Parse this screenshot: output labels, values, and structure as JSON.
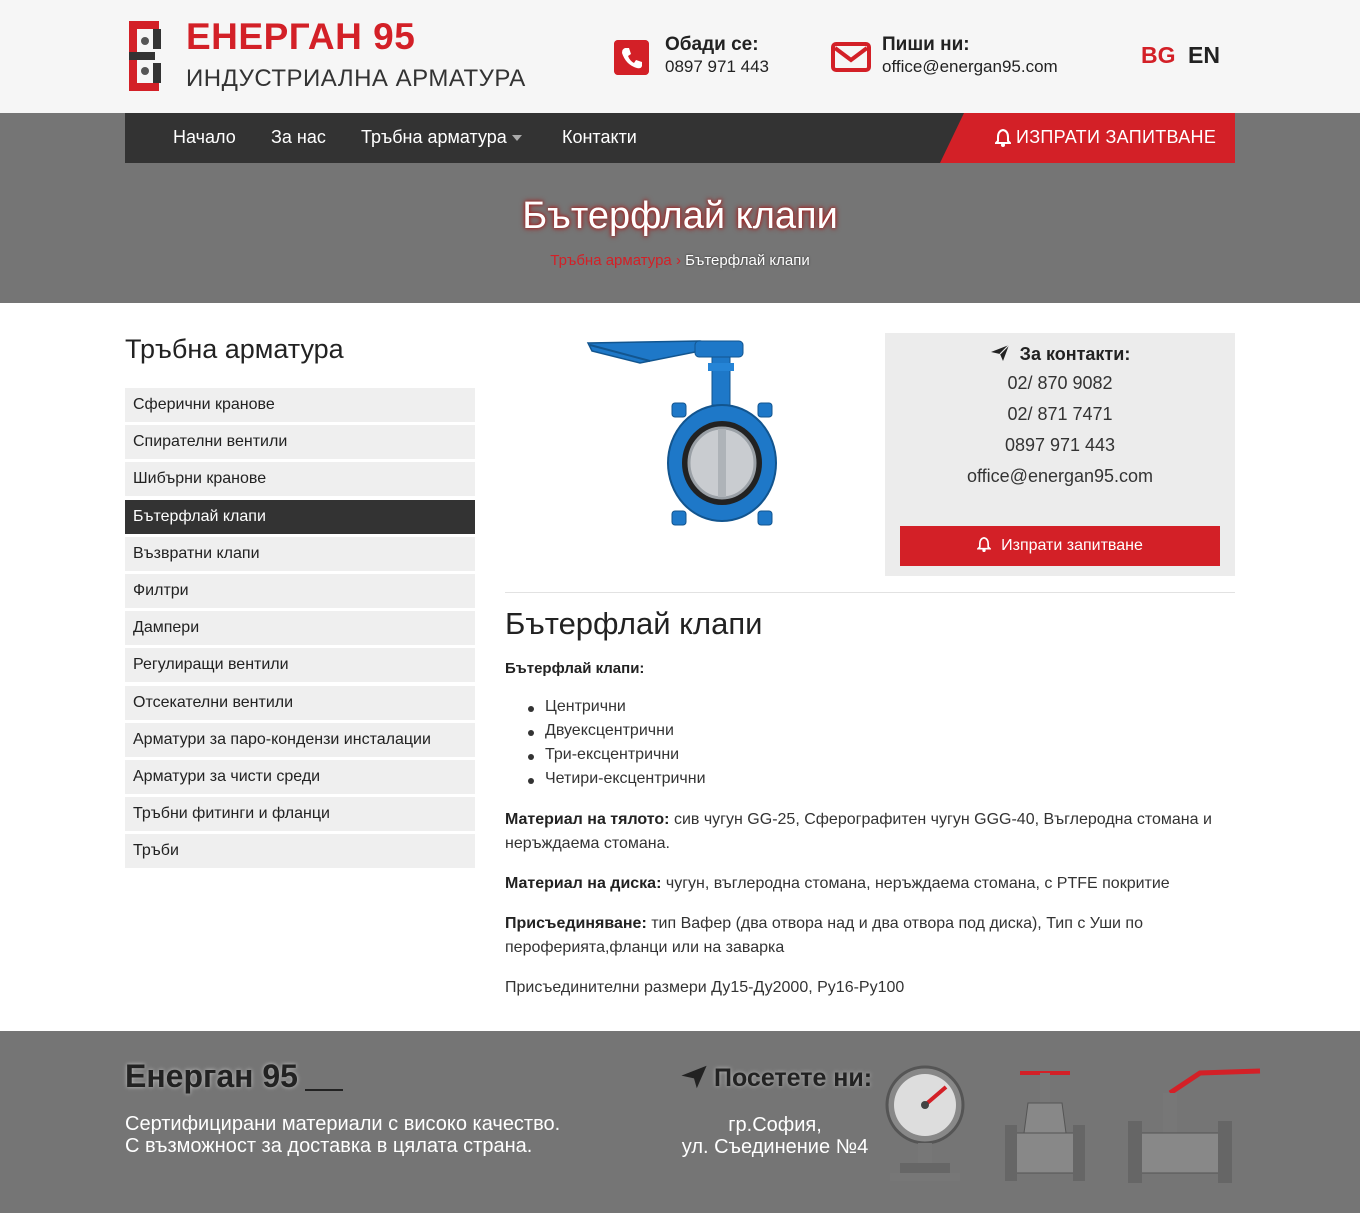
{
  "header": {
    "brand_name": "ЕНЕРГАН 95",
    "brand_tagline": "ИНДУСТРИАЛНА АРМАТУРА",
    "phone_label": "Обади се:",
    "phone_value": "0897 971 443",
    "mail_label": "Пиши ни:",
    "mail_value": "office@energan95.com",
    "lang_bg": "BG",
    "lang_en": "EN"
  },
  "nav": {
    "items": [
      {
        "label": "Начало"
      },
      {
        "label": "За нас"
      },
      {
        "label": "Тръбна арматура"
      },
      {
        "label": "Контакти"
      }
    ],
    "inquiry_label": "ИЗПРАТИ ЗАПИТВАНЕ"
  },
  "hero": {
    "title": "Бътерфлай клапи",
    "breadcrumb_parent": "Тръбна арматура",
    "breadcrumb_sep": "›",
    "breadcrumb_current": "Бътерфлай клапи"
  },
  "sidebar": {
    "title": "Тръбна арматура",
    "items": [
      {
        "label": "Сферични кранове"
      },
      {
        "label": "Спирателни вентили"
      },
      {
        "label": "Шибърни кранове"
      },
      {
        "label": "Бътерфлай клапи"
      },
      {
        "label": "Възвратни клапи"
      },
      {
        "label": "Филтри"
      },
      {
        "label": "Дампери"
      },
      {
        "label": "Регулиращи вентили"
      },
      {
        "label": "Отсекателни вентили"
      },
      {
        "label": "Арматури за паро-кондензи инсталации"
      },
      {
        "label": "Арматури за чисти среди"
      },
      {
        "label": "Тръбни фитинги и фланци"
      },
      {
        "label": "Тръби"
      }
    ],
    "active_index": 3
  },
  "contact_panel": {
    "title": "За контакти:",
    "lines": [
      "02/ 870 9082",
      "02/ 871 7471",
      "0897 971 443",
      "office@energan95.com"
    ],
    "button_label": "Изпрати запитване"
  },
  "article": {
    "title": "Бътерфлай клапи",
    "subtitle": "Бътерфлай клапи:",
    "bullets": [
      "Центрични",
      "Двуексцентрични",
      "Три-ексцентрични",
      "Четири-ексцентрични"
    ],
    "body_material_label": "Материал на тялото:",
    "body_material_text": " сив чугун GG-25, Сферографитен чугун GGG-40, Въглеродна стомана и неръждаема стомана.",
    "disc_material_label": "Материал на диска:",
    "disc_material_text": " чугун, въглеродна стомана, неръждаема стомана, с PTFE покритие",
    "connection_label": "Присъединяване:",
    "connection_text": " тип Вафер (два отвора над и два отвора под диска), Тип с Уши по пероферията,фланци или на заварка",
    "dimensions_text": "Присъединителни размери Ду15-Ду2000, Ру16-Ру100"
  },
  "footer": {
    "brand": "Енерган 95",
    "text_line1": "Сертифицирани материали с високо качество.",
    "text_line2": "С възможност за доставка в цялата страна.",
    "visit_title": "Посетете ни:",
    "addr_line1": "гр.София,",
    "addr_line2": "ул. Съединение №4"
  },
  "colors": {
    "accent": "#d32027",
    "dark": "#333333",
    "band": "#757575",
    "valve_blue": "#1e78c8"
  },
  "icons": [
    "phone-icon",
    "mail-icon",
    "bell-icon",
    "paper-plane-icon",
    "chevron-down-icon"
  ]
}
